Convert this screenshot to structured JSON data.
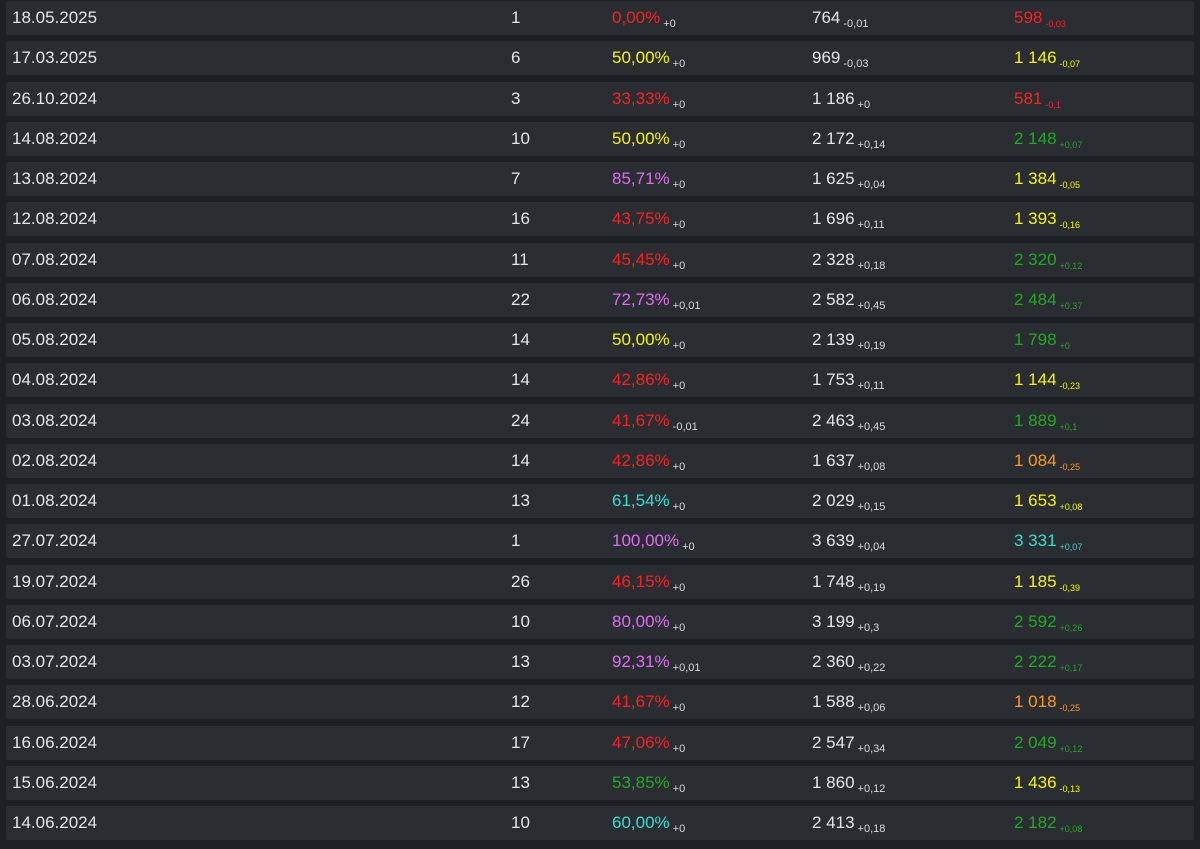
{
  "colors": {
    "red": "#ff2020",
    "yellow": "#f5f500",
    "violet": "#e06cf0",
    "cyan": "#33e0d0",
    "green": "#22aa22",
    "orange": "#ff9a1a"
  },
  "rows": [
    {
      "date": "18.05.2025",
      "count": "1",
      "pct": "0,00%",
      "pct_delta": "+0",
      "pct_color": "red",
      "rating": "764",
      "rating_delta": "-0,01",
      "perf": "598",
      "perf_delta": "-0,03",
      "perf_color": "red"
    },
    {
      "date": "17.03.2025",
      "count": "6",
      "pct": "50,00%",
      "pct_delta": "+0",
      "pct_color": "yellow",
      "rating": "969",
      "rating_delta": "-0,03",
      "perf": "1 146",
      "perf_delta": "-0,07",
      "perf_color": "yellow"
    },
    {
      "date": "26.10.2024",
      "count": "3",
      "pct": "33,33%",
      "pct_delta": "+0",
      "pct_color": "red",
      "rating": "1 186",
      "rating_delta": "+0",
      "perf": "581",
      "perf_delta": "-0,1",
      "perf_color": "red"
    },
    {
      "date": "14.08.2024",
      "count": "10",
      "pct": "50,00%",
      "pct_delta": "+0",
      "pct_color": "yellow",
      "rating": "2 172",
      "rating_delta": "+0,14",
      "perf": "2 148",
      "perf_delta": "+0,07",
      "perf_color": "green"
    },
    {
      "date": "13.08.2024",
      "count": "7",
      "pct": "85,71%",
      "pct_delta": "+0",
      "pct_color": "violet",
      "rating": "1 625",
      "rating_delta": "+0,04",
      "perf": "1 384",
      "perf_delta": "-0,05",
      "perf_color": "yellow"
    },
    {
      "date": "12.08.2024",
      "count": "16",
      "pct": "43,75%",
      "pct_delta": "+0",
      "pct_color": "red",
      "rating": "1 696",
      "rating_delta": "+0,11",
      "perf": "1 393",
      "perf_delta": "-0,16",
      "perf_color": "yellow"
    },
    {
      "date": "07.08.2024",
      "count": "11",
      "pct": "45,45%",
      "pct_delta": "+0",
      "pct_color": "red",
      "rating": "2 328",
      "rating_delta": "+0,18",
      "perf": "2 320",
      "perf_delta": "+0,12",
      "perf_color": "green"
    },
    {
      "date": "06.08.2024",
      "count": "22",
      "pct": "72,73%",
      "pct_delta": "+0,01",
      "pct_color": "violet",
      "rating": "2 582",
      "rating_delta": "+0,45",
      "perf": "2 484",
      "perf_delta": "+0,37",
      "perf_color": "green"
    },
    {
      "date": "05.08.2024",
      "count": "14",
      "pct": "50,00%",
      "pct_delta": "+0",
      "pct_color": "yellow",
      "rating": "2 139",
      "rating_delta": "+0,19",
      "perf": "1 798",
      "perf_delta": "+0",
      "perf_color": "green"
    },
    {
      "date": "04.08.2024",
      "count": "14",
      "pct": "42,86%",
      "pct_delta": "+0",
      "pct_color": "red",
      "rating": "1 753",
      "rating_delta": "+0,11",
      "perf": "1 144",
      "perf_delta": "-0,23",
      "perf_color": "yellow"
    },
    {
      "date": "03.08.2024",
      "count": "24",
      "pct": "41,67%",
      "pct_delta": "-0,01",
      "pct_color": "red",
      "rating": "2 463",
      "rating_delta": "+0,45",
      "perf": "1 889",
      "perf_delta": "+0,1",
      "perf_color": "green"
    },
    {
      "date": "02.08.2024",
      "count": "14",
      "pct": "42,86%",
      "pct_delta": "+0",
      "pct_color": "red",
      "rating": "1 637",
      "rating_delta": "+0,08",
      "perf": "1 084",
      "perf_delta": "-0,25",
      "perf_color": "orange"
    },
    {
      "date": "01.08.2024",
      "count": "13",
      "pct": "61,54%",
      "pct_delta": "+0",
      "pct_color": "cyan",
      "rating": "2 029",
      "rating_delta": "+0,15",
      "perf": "1 653",
      "perf_delta": "+0,08",
      "perf_color": "yellow"
    },
    {
      "date": "27.07.2024",
      "count": "1",
      "pct": "100,00%",
      "pct_delta": "+0",
      "pct_color": "violet",
      "rating": "3 639",
      "rating_delta": "+0,04",
      "perf": "3 331",
      "perf_delta": "+0,07",
      "perf_color": "cyan"
    },
    {
      "date": "19.07.2024",
      "count": "26",
      "pct": "46,15%",
      "pct_delta": "+0",
      "pct_color": "red",
      "rating": "1 748",
      "rating_delta": "+0,19",
      "perf": "1 185",
      "perf_delta": "-0,39",
      "perf_color": "yellow"
    },
    {
      "date": "06.07.2024",
      "count": "10",
      "pct": "80,00%",
      "pct_delta": "+0",
      "pct_color": "violet",
      "rating": "3 199",
      "rating_delta": "+0,3",
      "perf": "2 592",
      "perf_delta": "+0,26",
      "perf_color": "green"
    },
    {
      "date": "03.07.2024",
      "count": "13",
      "pct": "92,31%",
      "pct_delta": "+0,01",
      "pct_color": "violet",
      "rating": "2 360",
      "rating_delta": "+0,22",
      "perf": "2 222",
      "perf_delta": "+0,17",
      "perf_color": "green"
    },
    {
      "date": "28.06.2024",
      "count": "12",
      "pct": "41,67%",
      "pct_delta": "+0",
      "pct_color": "red",
      "rating": "1 588",
      "rating_delta": "+0,06",
      "perf": "1 018",
      "perf_delta": "-0,25",
      "perf_color": "orange"
    },
    {
      "date": "16.06.2024",
      "count": "17",
      "pct": "47,06%",
      "pct_delta": "+0",
      "pct_color": "red",
      "rating": "2 547",
      "rating_delta": "+0,34",
      "perf": "2 049",
      "perf_delta": "+0,12",
      "perf_color": "green"
    },
    {
      "date": "15.06.2024",
      "count": "13",
      "pct": "53,85%",
      "pct_delta": "+0",
      "pct_color": "green",
      "rating": "1 860",
      "rating_delta": "+0,12",
      "perf": "1 436",
      "perf_delta": "-0,13",
      "perf_color": "yellow"
    },
    {
      "date": "14.06.2024",
      "count": "10",
      "pct": "60,00%",
      "pct_delta": "+0",
      "pct_color": "cyan",
      "rating": "2 413",
      "rating_delta": "+0,18",
      "perf": "2 182",
      "perf_delta": "+0,08",
      "perf_color": "green"
    }
  ]
}
